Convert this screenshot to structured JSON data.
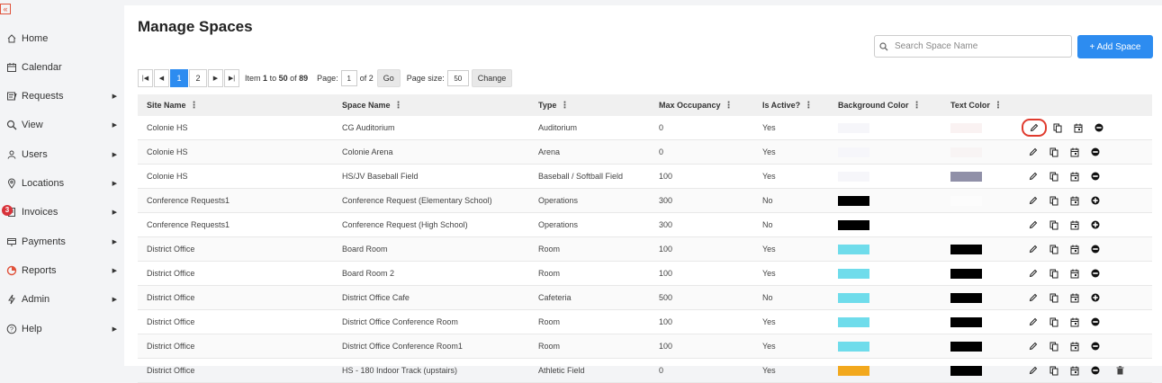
{
  "sidebar": {
    "collapse_icon": "double-chevron-left-icon",
    "items": [
      {
        "label": "Home",
        "icon": "home-icon",
        "arrow": false
      },
      {
        "label": "Calendar",
        "icon": "calendar-icon",
        "arrow": false
      },
      {
        "label": "Requests",
        "icon": "requests-icon",
        "arrow": true
      },
      {
        "label": "View",
        "icon": "search-icon",
        "arrow": true
      },
      {
        "label": "Users",
        "icon": "users-icon",
        "arrow": true
      },
      {
        "label": "Locations",
        "icon": "location-pin-icon",
        "arrow": true
      },
      {
        "label": "Invoices",
        "icon": "invoice-icon",
        "arrow": true,
        "badge": "3"
      },
      {
        "label": "Payments",
        "icon": "payments-icon",
        "arrow": true
      },
      {
        "label": "Reports",
        "icon": "reports-icon",
        "arrow": true
      },
      {
        "label": "Admin",
        "icon": "admin-icon",
        "arrow": true
      },
      {
        "label": "Help",
        "icon": "help-icon",
        "arrow": true
      }
    ]
  },
  "main": {
    "title": "Manage Spaces",
    "search_placeholder": "Search Space Name",
    "add_button": "+ Add Space"
  },
  "pager": {
    "pages": [
      "1",
      "2"
    ],
    "current_page": "1",
    "item_prefix": "Item",
    "item_from": "1",
    "item_to_word": "to",
    "item_to": "50",
    "item_of_word": "of",
    "item_total": "89",
    "page_label": "Page:",
    "page_value": "1",
    "of_pages": "of 2",
    "go_label": "Go",
    "page_size_label": "Page size:",
    "page_size_value": "50",
    "change_label": "Change"
  },
  "table": {
    "columns": [
      "Site Name",
      "Space Name",
      "Type",
      "Max Occupancy",
      "Is Active?",
      "Background Color",
      "Text Color"
    ],
    "rows": [
      {
        "site": "Colonie HS",
        "space": "CG Auditorium",
        "type": "Auditorium",
        "max": "0",
        "active": "Yes",
        "bg": "#f6f6fa",
        "text": "#faf2f2",
        "toggle": "deactivate"
      },
      {
        "site": "Colonie HS",
        "space": "Colonie Arena",
        "type": "Arena",
        "max": "0",
        "active": "Yes",
        "bg": "#f6f6fa",
        "text": "#f8f4f4",
        "toggle": "deactivate"
      },
      {
        "site": "Colonie HS",
        "space": "HS/JV Baseball Field",
        "type": "Baseball / Softball Field",
        "max": "100",
        "active": "Yes",
        "bg": "#f6f6fa",
        "text": "#9090a8",
        "toggle": "deactivate"
      },
      {
        "site": "Conference Requests1",
        "space": "Conference Request (Elementary School)",
        "type": "Operations",
        "max": "300",
        "active": "No",
        "bg": "#000000",
        "text": "#fcfcfc",
        "toggle": "activate"
      },
      {
        "site": "Conference Requests1",
        "space": "Conference Request (High School)",
        "type": "Operations",
        "max": "300",
        "active": "No",
        "bg": "#000000",
        "text": "#ffffff",
        "toggle": "activate"
      },
      {
        "site": "District Office",
        "space": "Board Room",
        "type": "Room",
        "max": "100",
        "active": "Yes",
        "bg": "#6fdceb",
        "text": "#000000",
        "toggle": "deactivate"
      },
      {
        "site": "District Office",
        "space": "Board Room 2",
        "type": "Room",
        "max": "100",
        "active": "Yes",
        "bg": "#6fdceb",
        "text": "#000000",
        "toggle": "deactivate"
      },
      {
        "site": "District Office",
        "space": "District Office Cafe",
        "type": "Cafeteria",
        "max": "500",
        "active": "No",
        "bg": "#6fdceb",
        "text": "#000000",
        "toggle": "activate"
      },
      {
        "site": "District Office",
        "space": "District Office Conference Room",
        "type": "Room",
        "max": "100",
        "active": "Yes",
        "bg": "#6fdceb",
        "text": "#000000",
        "toggle": "deactivate"
      },
      {
        "site": "District Office",
        "space": "District Office Conference Room1",
        "type": "Room",
        "max": "100",
        "active": "Yes",
        "bg": "#6fdceb",
        "text": "#000000",
        "toggle": "deactivate"
      },
      {
        "site": "District Office",
        "space": "HS - 180 Indoor Track (upstairs)",
        "type": "Athletic Field",
        "max": "0",
        "active": "Yes",
        "bg": "#f2a81d",
        "text": "#000000",
        "toggle": "deactivate",
        "extra": "trash-icon"
      }
    ]
  },
  "colors": {
    "accent": "#2d8cf0",
    "highlight_ring": "#e03b2e",
    "badge": "#d8323a"
  }
}
